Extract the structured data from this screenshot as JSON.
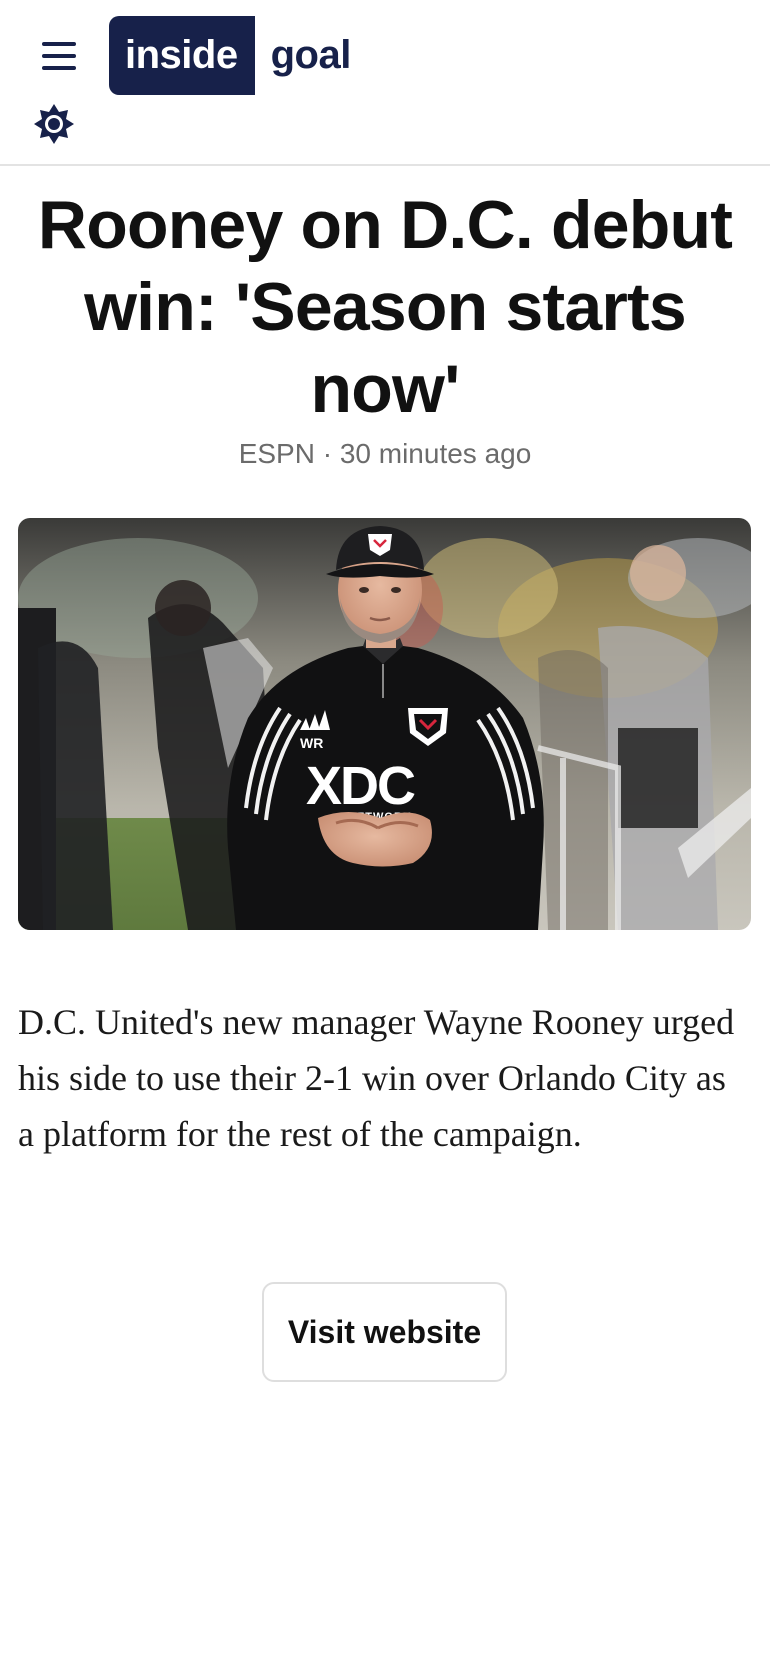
{
  "header": {
    "logo_primary": "inside",
    "logo_secondary": "goal",
    "menu_icon": "hamburger-menu-icon",
    "theme_icon": "sun-icon",
    "brand_color": "#17214a"
  },
  "article": {
    "title": "Rooney on D.C. debut win: 'Season starts now'",
    "meta": "ESPN · 30 minutes ago",
    "summary": "D.C. United's new manager Wayne Rooney urged his side to use their 2-1 win over Orlando City as a platform for the rest of the campaign.",
    "image": {
      "jacket_initials": "WR",
      "sponsor": "XDC",
      "sponsor_sub": "NETWORK"
    }
  },
  "actions": {
    "visit_label": "Visit website"
  }
}
